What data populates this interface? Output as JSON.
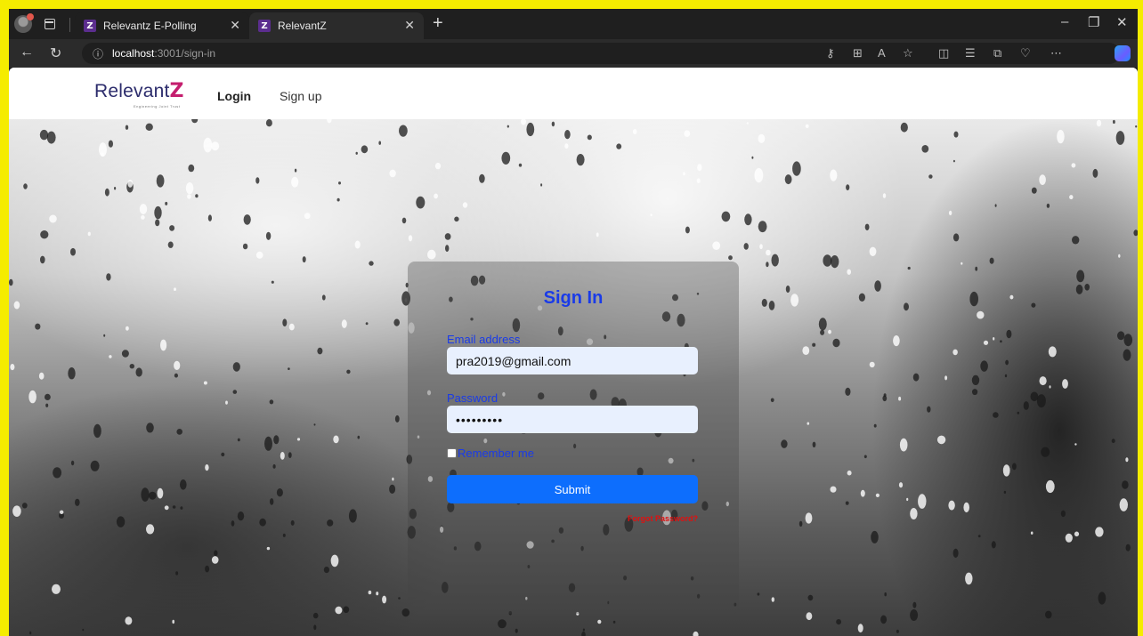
{
  "browser": {
    "tabs": [
      {
        "title": "Relevantz E-Polling",
        "favicon": "Z",
        "active": false
      },
      {
        "title": "RelevantZ",
        "favicon": "Z",
        "active": true
      }
    ],
    "close_glyph": "✕",
    "new_tab_glyph": "+",
    "url_host": "localhost",
    "url_path": ":3001/sign-in",
    "icons": [
      "back-icon",
      "refresh-icon",
      "info-icon",
      "password-key-icon",
      "app-grid-icon",
      "read-aloud-icon",
      "favorite-star-icon",
      "split-screen-icon",
      "favorites-icon",
      "collections-icon",
      "heart-pulse-icon",
      "more-icon",
      "copilot-icon"
    ]
  },
  "navbar": {
    "brand": "Relevant",
    "brand_z": "Z",
    "brand_tagline": "Engineering Joint Trust",
    "login": "Login",
    "signup": "Sign up"
  },
  "signin": {
    "title": "Sign In",
    "email_label": "Email address",
    "email_value": "pra2019@gmail.com",
    "password_label": "Password",
    "password_value": "•••••••••",
    "remember_label": "Remember me",
    "submit_label": "Submit",
    "forgot_label": "Forgot Password?"
  },
  "colors": {
    "accent": "#1a3be8",
    "submit_bg": "#0d6efd",
    "forgot": "#e01010",
    "brand_z": "#c41e6e",
    "frame": "#f5ec00"
  }
}
